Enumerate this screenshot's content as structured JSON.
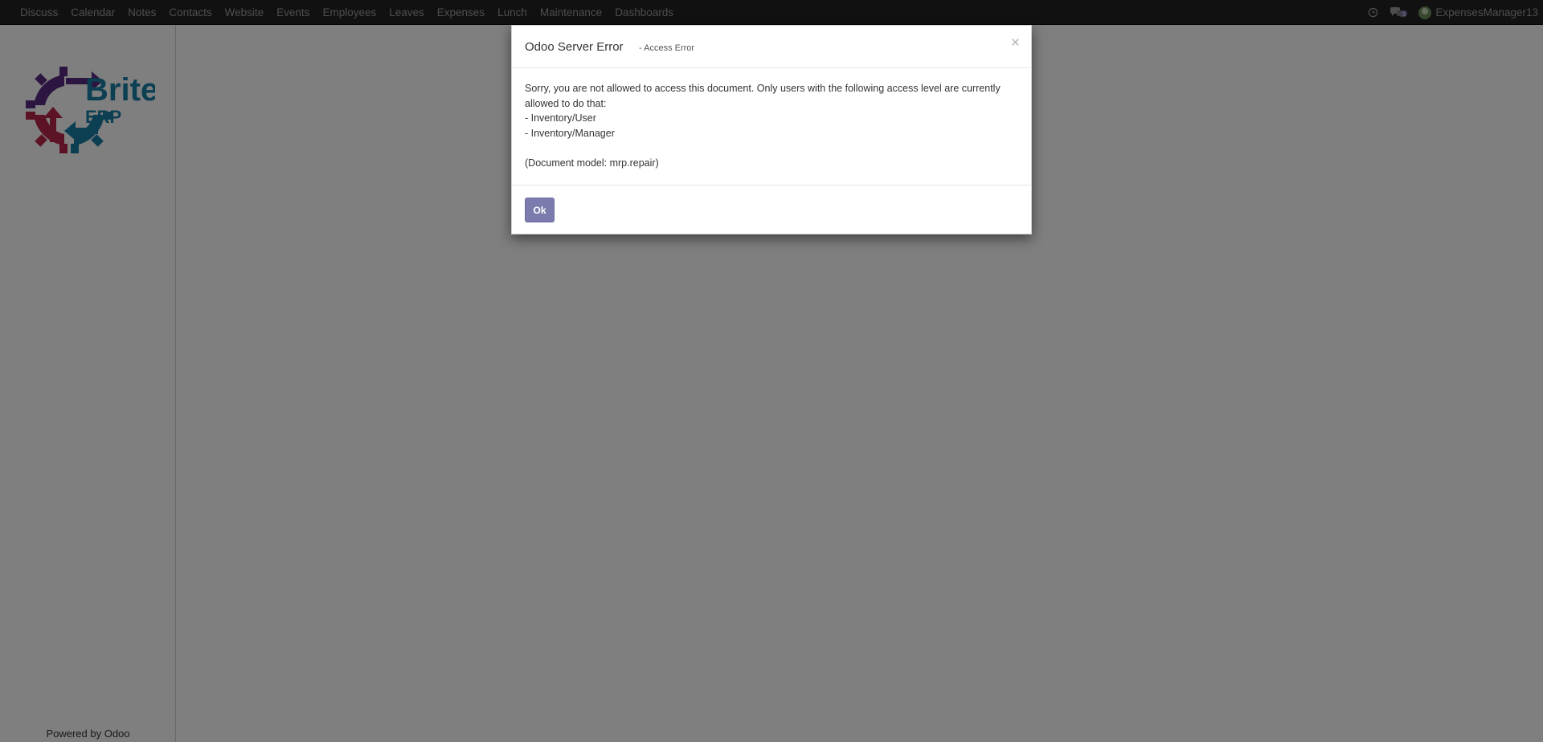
{
  "topbar": {
    "menu": [
      {
        "label": "Discuss"
      },
      {
        "label": "Calendar"
      },
      {
        "label": "Notes"
      },
      {
        "label": "Contacts"
      },
      {
        "label": "Website"
      },
      {
        "label": "Events"
      },
      {
        "label": "Employees"
      },
      {
        "label": "Leaves"
      },
      {
        "label": "Expenses"
      },
      {
        "label": "Lunch"
      },
      {
        "label": "Maintenance"
      },
      {
        "label": "Dashboards"
      }
    ],
    "systray": {
      "activity_icon": "clock-icon",
      "messages_icon": "chat-icon",
      "messages_count": "1",
      "user_name": "ExpensesManager13"
    }
  },
  "sidebar": {
    "logo_text_top": "Brite",
    "logo_text_bottom": "ERP",
    "powered_prefix": "Powered by ",
    "powered_link": "Odoo"
  },
  "dialog": {
    "title": "Odoo Server Error",
    "subtitle": "- Access Error",
    "close_symbol": "×",
    "message_line1": "Sorry, you are not allowed to access this document. Only users with the following access level are currently allowed to do that:",
    "access_levels": [
      "- Inventory/User",
      "- Inventory/Manager"
    ],
    "document_model": "(Document model: mrp.repair)",
    "ok_label": "Ok"
  },
  "colors": {
    "topbar_bg": "#222222",
    "primary_button": "#7c7bad",
    "logo_purple": "#5a2a82",
    "logo_red": "#b8264d",
    "logo_blue": "#1a7fa6"
  }
}
